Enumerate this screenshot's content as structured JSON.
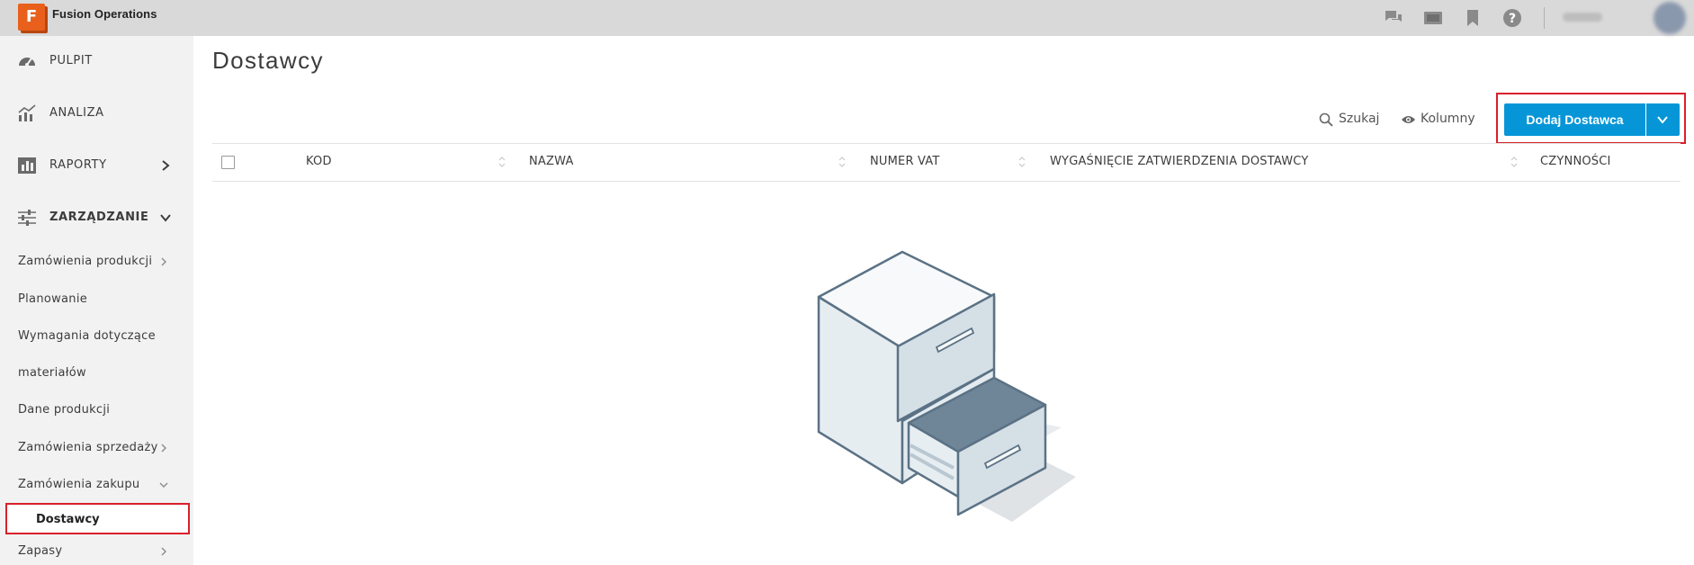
{
  "app": {
    "title": "Fusion Operations",
    "logo_letter": "F"
  },
  "topbar": {
    "icons": [
      "chat-icon",
      "screen-icon",
      "bookmark-icon",
      "help-icon"
    ]
  },
  "sidebar": {
    "main_items": [
      {
        "label": "PULPIT",
        "icon": "gauge-icon"
      },
      {
        "label": "ANALIZA",
        "icon": "analytics-icon"
      },
      {
        "label": "RAPORTY",
        "icon": "reports-icon",
        "chevron": "right"
      },
      {
        "label": "ZARZĄDZANIE",
        "icon": "sliders-icon",
        "chevron": "down"
      }
    ],
    "sub_items": [
      {
        "label": "Zamówienia produkcji",
        "chevron": "right"
      },
      {
        "label": "Planowanie"
      },
      {
        "label": "Wymagania dotyczące"
      },
      {
        "label": "materiałów"
      },
      {
        "label": "Dane produkcji"
      },
      {
        "label": "Zamówienia sprzedaży",
        "chevron": "right"
      },
      {
        "label": "Zamówienia zakupu",
        "chevron": "down"
      }
    ],
    "active_item": "Dostawcy",
    "after_items": [
      {
        "label": "Zapasy",
        "chevron": "right"
      }
    ]
  },
  "main": {
    "title": "Dostawcy",
    "toolbar": {
      "search_label": "Szukaj",
      "columns_label": "Kolumny",
      "add_label": "Dodaj Dostawca"
    },
    "table": {
      "columns": [
        "KOD",
        "NAZWA",
        "NUMER VAT",
        "WYGAŚNIĘCIE ZATWIERDZENIA DOSTAWCY",
        "CZYNNOŚCI"
      ]
    }
  },
  "colors": {
    "accent": "#0696d7",
    "highlight": "#d8202a",
    "brand": "#e8601c"
  }
}
